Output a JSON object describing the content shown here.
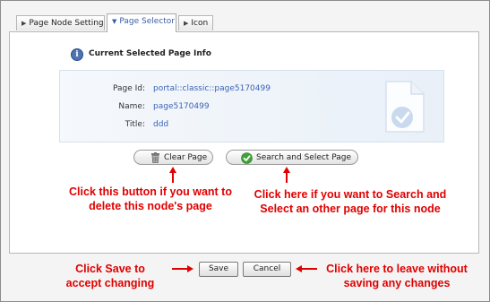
{
  "tabs": [
    {
      "label": "Page Node Setting",
      "active": false
    },
    {
      "label": "Page Selector",
      "active": true
    },
    {
      "label": "Icon",
      "active": false
    }
  ],
  "info": {
    "title": "Current Selected Page Info",
    "fields": [
      {
        "label": "Page Id:",
        "value": "portal::classic::page5170499"
      },
      {
        "label": "Name:",
        "value": "page5170499"
      },
      {
        "label": "Title:",
        "value": "ddd"
      }
    ]
  },
  "buttons": {
    "clear_page": "Clear Page",
    "search_select": "Search and Select Page",
    "save": "Save",
    "cancel": "Cancel"
  },
  "annotations": {
    "clear_line1": "Click this button if you want to",
    "clear_line2": "delete this node's page",
    "search_line1": "Click here if you want to Search and",
    "search_line2": "Select an other page for this node",
    "save_line1": "Click Save to",
    "save_line2": "accept changing",
    "cancel_line1": "Click here to leave without",
    "cancel_line2": "saving any changes"
  },
  "colors": {
    "annotation_red": "#e00000",
    "link_blue": "#3b63b4",
    "active_tab_text": "#3a5fa8"
  },
  "icons": [
    "info-icon",
    "trash-icon",
    "check-icon",
    "document-check-icon",
    "tab-arrow-icon"
  ]
}
